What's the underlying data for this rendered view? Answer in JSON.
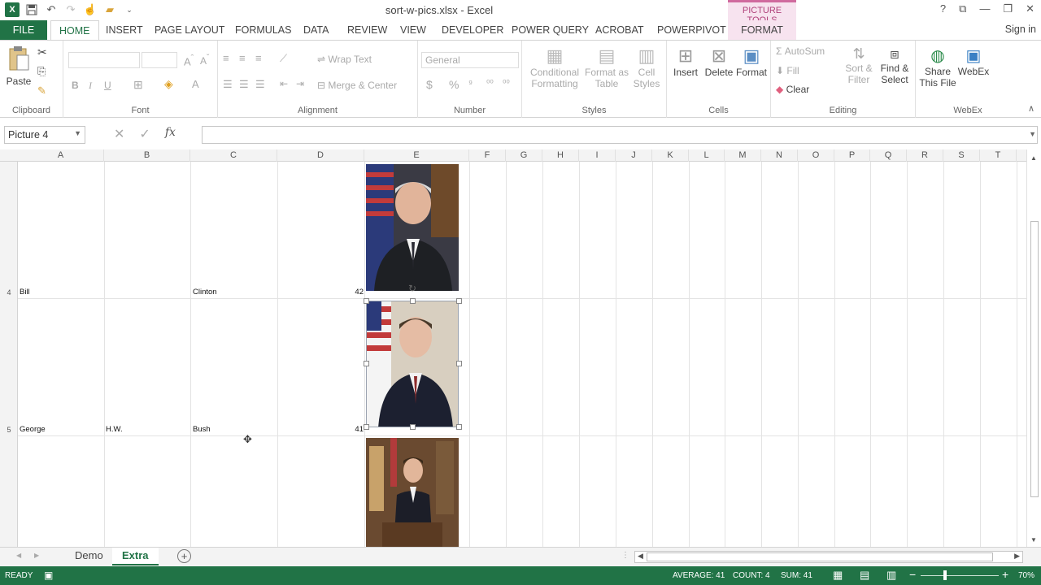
{
  "window": {
    "title": "sort-w-pics.xlsx - Excel",
    "context_tab_group": "PICTURE TOOLS",
    "sign_in": "Sign in",
    "controls": [
      "?",
      "⧉",
      "—",
      "❐",
      "✕"
    ]
  },
  "ribbon_tabs": [
    "FILE",
    "HOME",
    "INSERT",
    "PAGE LAYOUT",
    "FORMULAS",
    "DATA",
    "REVIEW",
    "VIEW",
    "DEVELOPER",
    "POWER QUERY",
    "ACROBAT",
    "POWERPIVOT",
    "FORMAT"
  ],
  "ribbon": {
    "clipboard": {
      "label": "Clipboard",
      "paste": "Paste"
    },
    "font": {
      "label": "Font",
      "bold": "B",
      "italic": "I",
      "underline": "U"
    },
    "alignment": {
      "label": "Alignment",
      "wrap_text": "Wrap Text",
      "merge_center": "Merge & Center"
    },
    "number": {
      "label": "Number",
      "format": "General",
      "currency": "$",
      "percent": "%",
      "comma": "⁹"
    },
    "styles": {
      "label": "Styles",
      "conditional": "Conditional",
      "conditional2": "Formatting",
      "format_as": "Format as",
      "format_as2": "Table",
      "cell": "Cell",
      "cell2": "Styles"
    },
    "cells": {
      "label": "Cells",
      "insert": "Insert",
      "delete": "Delete",
      "format": "Format"
    },
    "editing": {
      "label": "Editing",
      "autosum": "AutoSum",
      "fill": "Fill",
      "clear": "Clear",
      "sort": "Sort &",
      "sort2": "Filter",
      "find": "Find &",
      "find2": "Select"
    },
    "webex": {
      "label": "WebEx",
      "share": "Share",
      "share2": "This File",
      "webex": "WebEx"
    }
  },
  "formula_bar": {
    "name_box": "Picture 4",
    "formula": ""
  },
  "columns": [
    "A",
    "B",
    "C",
    "D",
    "E",
    "F",
    "G",
    "H",
    "I",
    "J",
    "K",
    "L",
    "M",
    "N",
    "O",
    "P",
    "Q",
    "R",
    "S",
    "T"
  ],
  "rows": [
    {
      "num": "4",
      "a": "Bill",
      "b": "",
      "c": "Clinton",
      "d": "42"
    },
    {
      "num": "5",
      "a": "George",
      "b": "H.W.",
      "c": "Bush",
      "d": "41"
    }
  ],
  "sheets": [
    "Demo",
    "Extra"
  ],
  "active_sheet": "Extra",
  "status": {
    "mode": "READY",
    "average": "AVERAGE: 41",
    "count": "COUNT: 4",
    "sum": "SUM: 41",
    "zoom": "70%"
  },
  "colors": {
    "excel_green": "#217346",
    "picture_tools": "#b0417b"
  }
}
